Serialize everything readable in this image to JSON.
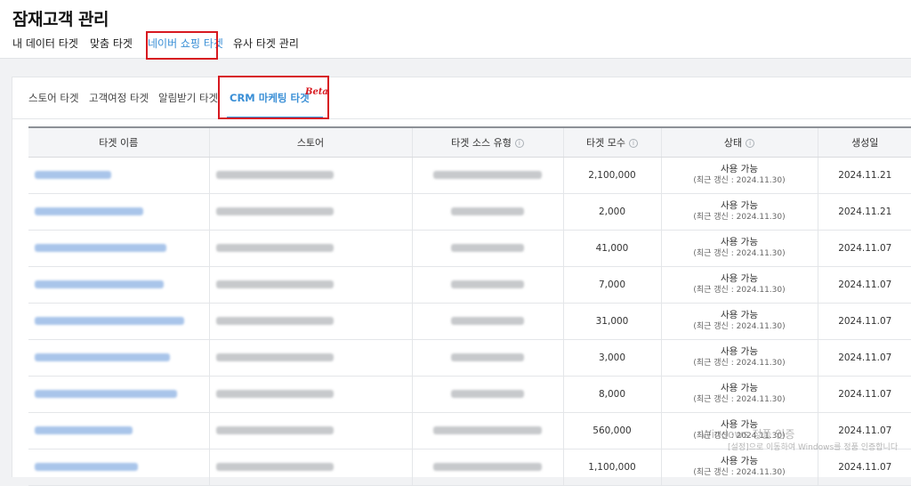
{
  "page": {
    "title": "잠재고객 관리"
  },
  "top_tabs": [
    "내 데이터 타겟",
    "맞춤 타겟",
    "네이버 쇼핑 타겟",
    "유사 타겟 관리"
  ],
  "sub_tabs": [
    "스토어 타겟",
    "고객여정 타겟",
    "알림받기 타겟",
    "CRM 마케팅 타겟"
  ],
  "beta_label": "Beta",
  "table": {
    "headers": [
      "타겟 이름",
      "스토어",
      "타겟 소스 유형",
      "타겟 모수",
      "상태",
      "생성일"
    ],
    "info_icon": "i",
    "rows": [
      {
        "size": "2,100,000",
        "status": "사용 가능",
        "updated": "(최근 갱신 : 2024.11.30)",
        "created": "2024.11.21"
      },
      {
        "size": "2,000",
        "status": "사용 가능",
        "updated": "(최근 갱신 : 2024.11.30)",
        "created": "2024.11.21"
      },
      {
        "size": "41,000",
        "status": "사용 가능",
        "updated": "(최근 갱신 : 2024.11.30)",
        "created": "2024.11.07"
      },
      {
        "size": "7,000",
        "status": "사용 가능",
        "updated": "(최근 갱신 : 2024.11.30)",
        "created": "2024.11.07"
      },
      {
        "size": "31,000",
        "status": "사용 가능",
        "updated": "(최근 갱신 : 2024.11.30)",
        "created": "2024.11.07"
      },
      {
        "size": "3,000",
        "status": "사용 가능",
        "updated": "(최근 갱신 : 2024.11.30)",
        "created": "2024.11.07"
      },
      {
        "size": "8,000",
        "status": "사용 가능",
        "updated": "(최근 갱신 : 2024.11.30)",
        "created": "2024.11.07"
      },
      {
        "size": "560,000",
        "status": "사용 가능",
        "updated": "(최근 갱신 : 2024.11.30)",
        "created": "2024.11.07"
      },
      {
        "size": "1,100,000",
        "status": "사용 가능",
        "updated": "(최근 갱신 : 2024.11.30)",
        "created": "2024.11.07"
      }
    ]
  },
  "watermark": {
    "line1": "Windows 정품 인증",
    "line2": "[설정]으로 이동하여 Windows를 정품 인증합니다"
  },
  "colors": {
    "accent": "#3a8fd6",
    "highlight_box": "#d71920"
  }
}
